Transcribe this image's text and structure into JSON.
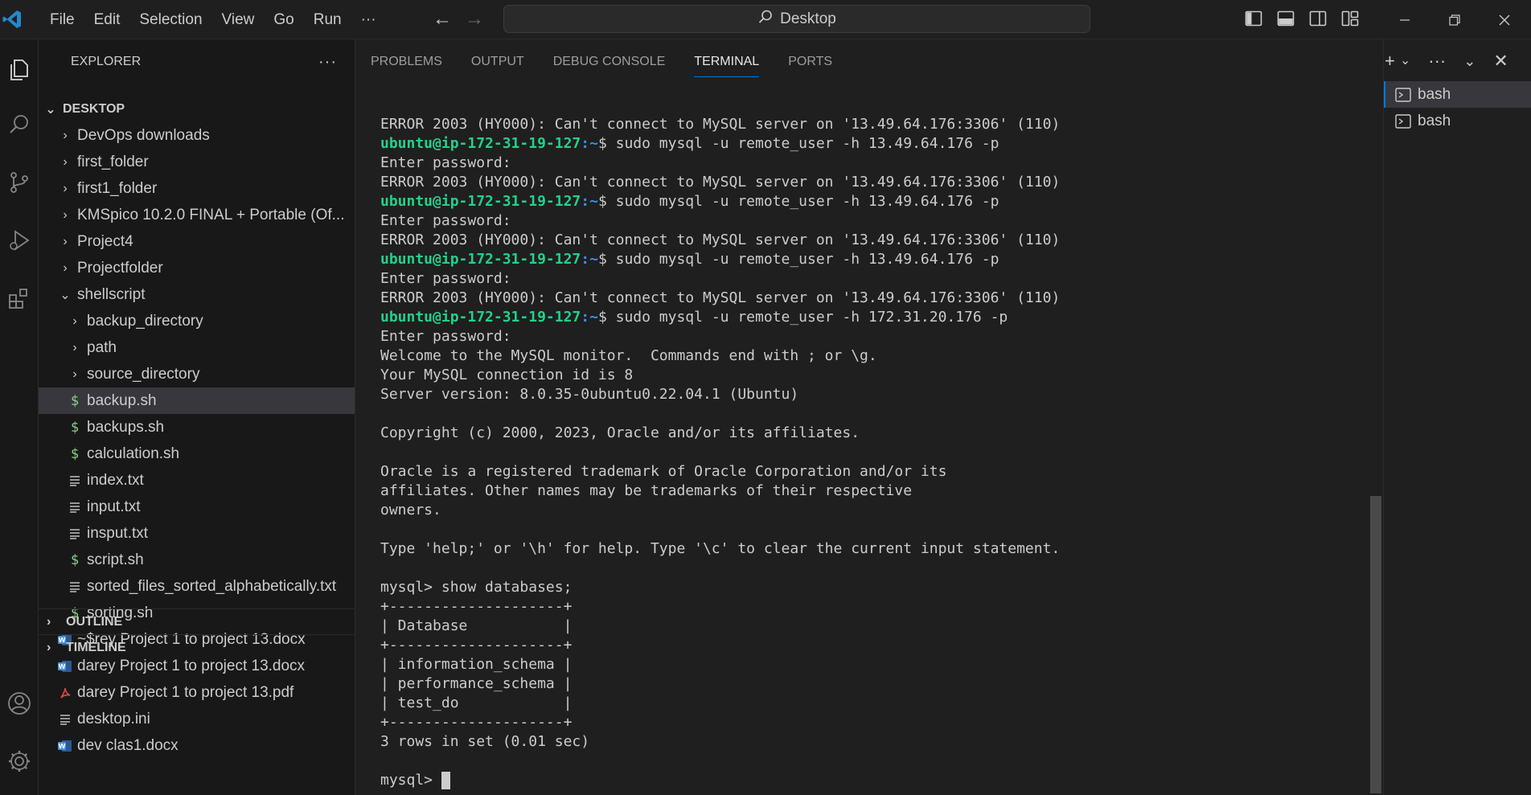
{
  "titlebar": {
    "menu": [
      "File",
      "Edit",
      "Selection",
      "View",
      "Go",
      "Run",
      "···"
    ],
    "search_label": "Desktop"
  },
  "sidebar": {
    "title": "EXPLORER",
    "more": "···",
    "root": "DESKTOP",
    "items": [
      {
        "label": "DevOps downloads",
        "kind": "folder",
        "depth": 1
      },
      {
        "label": "first_folder",
        "kind": "folder",
        "depth": 1
      },
      {
        "label": "first1_folder",
        "kind": "folder",
        "depth": 1
      },
      {
        "label": "KMSpico 10.2.0 FINAL + Portable (Of...",
        "kind": "folder",
        "depth": 1
      },
      {
        "label": "Project4",
        "kind": "folder",
        "depth": 1
      },
      {
        "label": "Projectfolder",
        "kind": "folder",
        "depth": 1
      },
      {
        "label": "shellscript",
        "kind": "folder-open",
        "depth": 1
      },
      {
        "label": "backup_directory",
        "kind": "folder",
        "depth": 2
      },
      {
        "label": "path",
        "kind": "folder",
        "depth": 2
      },
      {
        "label": "source_directory",
        "kind": "folder",
        "depth": 2
      },
      {
        "label": "backup.sh",
        "kind": "shell",
        "depth": 2,
        "selected": true
      },
      {
        "label": "backups.sh",
        "kind": "shell",
        "depth": 2
      },
      {
        "label": "calculation.sh",
        "kind": "shell",
        "depth": 2
      },
      {
        "label": "index.txt",
        "kind": "text",
        "depth": 2
      },
      {
        "label": "input.txt",
        "kind": "text",
        "depth": 2
      },
      {
        "label": "insput.txt",
        "kind": "text",
        "depth": 2
      },
      {
        "label": "script.sh",
        "kind": "shell",
        "depth": 2
      },
      {
        "label": "sorted_files_sorted_alphabetically.txt",
        "kind": "text",
        "depth": 2
      },
      {
        "label": "sorting.sh",
        "kind": "shell",
        "depth": 2
      },
      {
        "label": "~$rey Project 1 to project 13.docx",
        "kind": "word",
        "depth": 1
      },
      {
        "label": "darey Project 1 to project 13.docx",
        "kind": "word",
        "depth": 1
      },
      {
        "label": "darey Project 1 to project 13.pdf",
        "kind": "pdf",
        "depth": 1
      },
      {
        "label": "desktop.ini",
        "kind": "text",
        "depth": 1
      },
      {
        "label": "dev clas1.docx",
        "kind": "word",
        "depth": 1
      }
    ],
    "outline": "OUTLINE",
    "timeline": "TIMELINE"
  },
  "panel": {
    "tabs": [
      "PROBLEMS",
      "OUTPUT",
      "DEBUG CONSOLE",
      "TERMINAL",
      "PORTS"
    ],
    "active_tab": "TERMINAL"
  },
  "terminal": {
    "prompt_user": "ubuntu@ip-172-31-19-127",
    "prompt_path": ":~",
    "lines": [
      {
        "type": "text",
        "text": "ERROR 2003 (HY000): Can't connect to MySQL server on '13.49.64.176:3306' (110)"
      },
      {
        "type": "cmd",
        "text": "$ sudo mysql -u remote_user -h 13.49.64.176 -p"
      },
      {
        "type": "text",
        "text": "Enter password:"
      },
      {
        "type": "text",
        "text": "ERROR 2003 (HY000): Can't connect to MySQL server on '13.49.64.176:3306' (110)"
      },
      {
        "type": "cmd",
        "text": "$ sudo mysql -u remote_user -h 13.49.64.176 -p"
      },
      {
        "type": "text",
        "text": "Enter password:"
      },
      {
        "type": "text",
        "text": "ERROR 2003 (HY000): Can't connect to MySQL server on '13.49.64.176:3306' (110)"
      },
      {
        "type": "cmd",
        "text": "$ sudo mysql -u remote_user -h 13.49.64.176 -p"
      },
      {
        "type": "text",
        "text": "Enter password:"
      },
      {
        "type": "text",
        "text": "ERROR 2003 (HY000): Can't connect to MySQL server on '13.49.64.176:3306' (110)"
      },
      {
        "type": "cmd",
        "text": "$ sudo mysql -u remote_user -h 172.31.20.176 -p"
      },
      {
        "type": "text",
        "text": "Enter password:"
      },
      {
        "type": "text",
        "text": "Welcome to the MySQL monitor.  Commands end with ; or \\g."
      },
      {
        "type": "text",
        "text": "Your MySQL connection id is 8"
      },
      {
        "type": "text",
        "text": "Server version: 8.0.35-0ubuntu0.22.04.1 (Ubuntu)"
      },
      {
        "type": "text",
        "text": ""
      },
      {
        "type": "text",
        "text": "Copyright (c) 2000, 2023, Oracle and/or its affiliates."
      },
      {
        "type": "text",
        "text": ""
      },
      {
        "type": "text",
        "text": "Oracle is a registered trademark of Oracle Corporation and/or its"
      },
      {
        "type": "text",
        "text": "affiliates. Other names may be trademarks of their respective"
      },
      {
        "type": "text",
        "text": "owners."
      },
      {
        "type": "text",
        "text": ""
      },
      {
        "type": "text",
        "text": "Type 'help;' or '\\h' for help. Type '\\c' to clear the current input statement."
      },
      {
        "type": "text",
        "text": ""
      },
      {
        "type": "text",
        "text": "mysql> show databases;"
      },
      {
        "type": "text",
        "text": "+--------------------+"
      },
      {
        "type": "text",
        "text": "| Database           |"
      },
      {
        "type": "text",
        "text": "+--------------------+"
      },
      {
        "type": "text",
        "text": "| information_schema |"
      },
      {
        "type": "text",
        "text": "| performance_schema |"
      },
      {
        "type": "text",
        "text": "| test_do            |"
      },
      {
        "type": "text",
        "text": "+--------------------+"
      },
      {
        "type": "text",
        "text": "3 rows in set (0.01 sec)"
      },
      {
        "type": "text",
        "text": ""
      },
      {
        "type": "final",
        "text": "mysql> "
      }
    ]
  },
  "terminal_list": {
    "items": [
      {
        "label": "bash",
        "active": true
      },
      {
        "label": "bash",
        "active": false
      }
    ]
  },
  "colors": {
    "accent": "#0078d4",
    "prompt_user": "#23d18b",
    "prompt_path": "#3b8eea",
    "shell_icon": "#89d185",
    "word_icon": "#4a8fd8",
    "pdf_icon": "#e04848"
  }
}
